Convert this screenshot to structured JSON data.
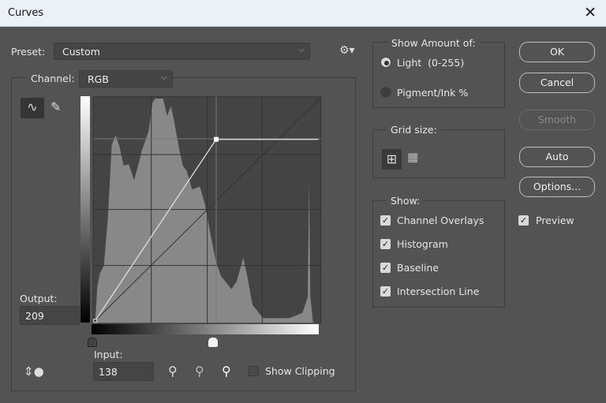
{
  "window": {
    "title": "Curves"
  },
  "preset": {
    "label": "Preset:",
    "value": "Custom"
  },
  "channel": {
    "label": "Channel:",
    "value": "RGB"
  },
  "output": {
    "label": "Output:",
    "value": "209"
  },
  "input": {
    "label": "Input:",
    "value": "138"
  },
  "show_clipping": {
    "label": "Show Clipping",
    "checked": false
  },
  "show_amount": {
    "title": "Show Amount of:",
    "options": [
      {
        "label": "Light  (0-255)",
        "selected": true
      },
      {
        "label": "Pigment/Ink %",
        "selected": false
      }
    ]
  },
  "grid_size": {
    "title": "Grid size:"
  },
  "show": {
    "title": "Show:",
    "items": [
      {
        "label": "Channel Overlays"
      },
      {
        "label": "Histogram"
      },
      {
        "label": "Baseline"
      },
      {
        "label": "Intersection Line"
      }
    ]
  },
  "buttons": {
    "ok": "OK",
    "cancel": "Cancel",
    "smooth": "Smooth",
    "auto": "Auto",
    "options": "Options..."
  },
  "preview": {
    "label": "Preview",
    "checked": true
  }
}
